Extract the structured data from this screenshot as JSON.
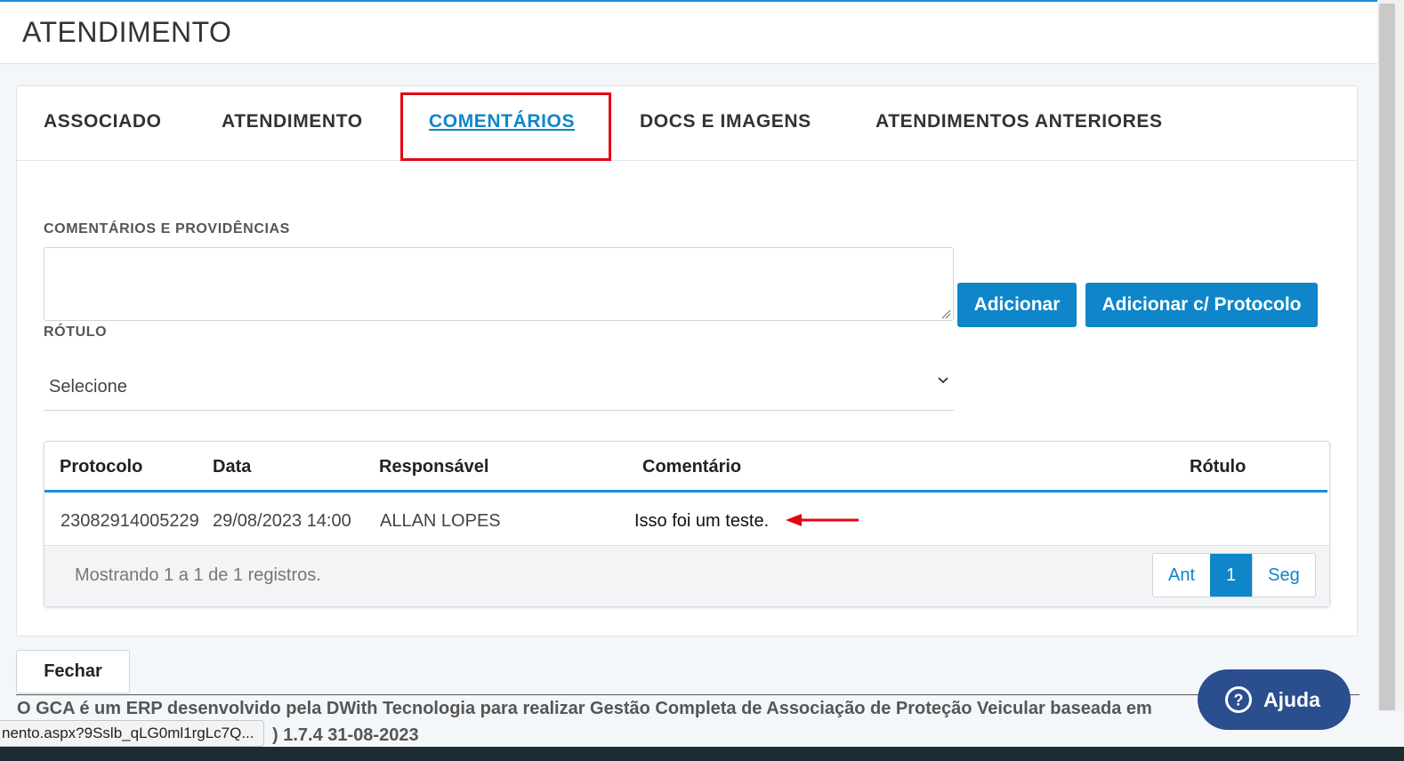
{
  "header": {
    "title": "ATENDIMENTO"
  },
  "tabs": [
    {
      "label": "ASSOCIADO"
    },
    {
      "label": "ATENDIMENTO"
    },
    {
      "label": "COMENTÁRIOS"
    },
    {
      "label": "DOCS E IMAGENS"
    },
    {
      "label": "ATENDIMENTOS ANTERIORES"
    }
  ],
  "active_tab": "COMENTÁRIOS",
  "form": {
    "comments_label": "COMENTÁRIOS E PROVIDÊNCIAS",
    "comments_value": "",
    "add_button": "Adicionar",
    "add_protocol_button": "Adicionar c/ Protocolo",
    "label_label": "RÓTULO",
    "label_selected": "Selecione"
  },
  "table": {
    "headers": [
      "Protocolo",
      "Data",
      "Responsável",
      "Comentário",
      "Rótulo"
    ],
    "rows": [
      [
        "23082914005229",
        "29/08/2023 14:00",
        "ALLAN LOPES",
        "Isso foi um teste.",
        ""
      ]
    ],
    "info": "Mostrando 1 a 1 de 1 registros.",
    "pager": {
      "prev": "Ant",
      "current": "1",
      "next": "Seg"
    }
  },
  "close_button": "Fechar",
  "footer": {
    "text": "O GCA é um ERP desenvolvido pela DWith Tecnologia para realizar Gestão Completa de Associação de Proteção Veicular baseada em",
    "version": ") 1.7.4 31-08-2023"
  },
  "status_url": "nento.aspx?9Sslb_qLG0ml1rgLc7Q...",
  "help": {
    "label": "Ajuda"
  },
  "colors": {
    "accent": "#0e86c9",
    "highlight": "#e30613",
    "help_bg": "#2b4e8f"
  }
}
